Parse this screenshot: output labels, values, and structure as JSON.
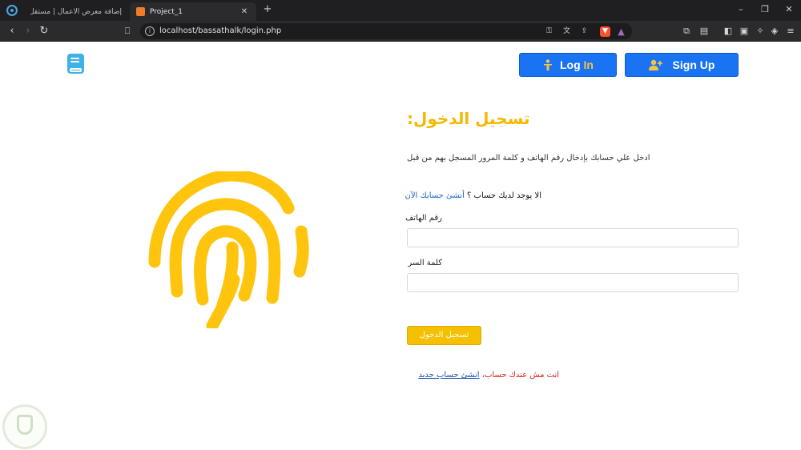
{
  "browser": {
    "tabs": [
      {
        "title": "إضافة معرض الأعمال | مستقل"
      },
      {
        "title": "Project_1"
      }
    ],
    "new_tab": "+",
    "url": "localhost/bassathalk/login.php",
    "window_controls": {
      "minimize": "–",
      "maximize": "❐",
      "close": "✕"
    }
  },
  "header": {
    "login_label_main": "Log ",
    "login_label_highlight": "In",
    "signup_label": "Sign Up"
  },
  "form": {
    "title": "تسجيل الدخول:",
    "description": "ادخل علي حسابك بإدخال رقم الهاتف و كلمة المرور المسجل بهم من قبل",
    "no_account_text": "الا يوجد لديك حساب ؟ ",
    "no_account_link": "أنشئ حسابك الآن",
    "phone_label": "رقم الهاتف",
    "phone_value": "",
    "password_label": "كلمة السر",
    "password_value": "",
    "submit_label": "تسجيل الدخول",
    "bottom_text": "انت مش عندك حساب، ",
    "bottom_link": "انشئ حساب جديد"
  },
  "colors": {
    "accent_yellow": "#f5b800",
    "primary_blue": "#1a73f2",
    "error_red": "#d41a1a",
    "logo_blue": "#3db1e8",
    "fingerprint_yellow": "#ffc40d"
  },
  "icons": {
    "login_icon": "person-standing-icon",
    "signup_icon": "user-plus-icon",
    "logo_icon": "book-icon",
    "hero_icon": "fingerprint-icon"
  }
}
